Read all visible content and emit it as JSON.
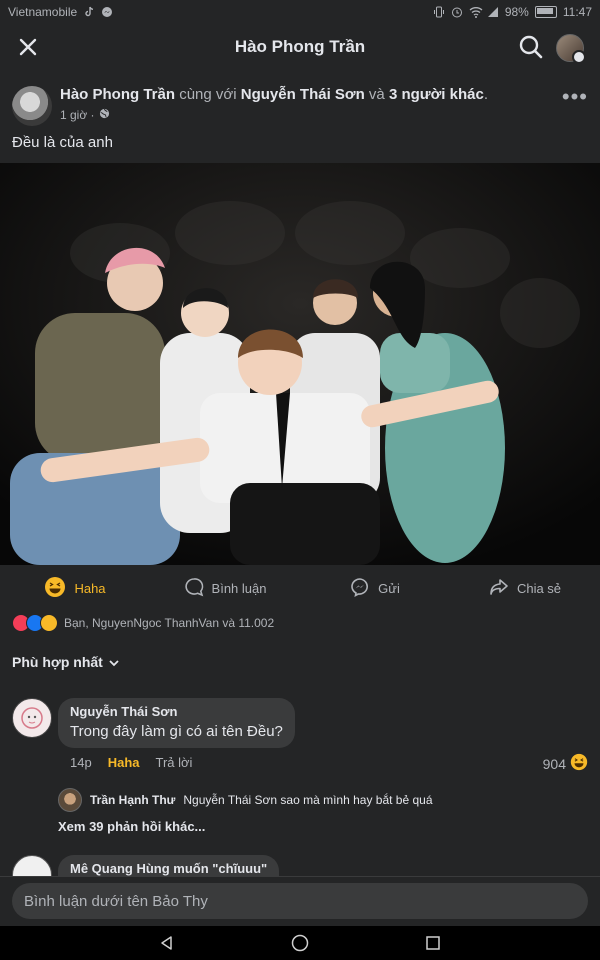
{
  "status_bar": {
    "carrier": "Vietnamobile",
    "battery": "98%",
    "time": "11:47"
  },
  "header": {
    "title": "Hào Phong Trần"
  },
  "post": {
    "author": "Hào Phong Trần",
    "with_text": "cùng với",
    "tagged": "Nguyễn Thái Sơn",
    "and_text": "và",
    "others": "3 người khác",
    "time": "1 giờ ·",
    "more": "•••",
    "caption": "Đều là của anh"
  },
  "actions": [
    {
      "label": "Haha",
      "icon": "haha-icon"
    },
    {
      "label": "Bình luận",
      "icon": "comment-icon"
    },
    {
      "label": "Gửi",
      "icon": "messenger-icon"
    },
    {
      "label": "Chia sẻ",
      "icon": "share-icon"
    }
  ],
  "reactions": {
    "summary": "Bạn, NguyenNgoc ThanhVan và 11.002"
  },
  "sort": {
    "label": "Phù hợp nhất"
  },
  "comments": [
    {
      "name": "Nguyễn Thái Sơn",
      "text": "Trong đây làm gì có ai tên Đều?",
      "time": "14p",
      "reaction_label": "Haha",
      "reply_label": "Trả lời",
      "count": "904"
    }
  ],
  "reply": {
    "name": "Trần Hạnh Thư",
    "text": "Nguyễn Thái Sơn sao mà mình hay bắt bẻ quá"
  },
  "more_replies": "Xem 39 phản hồi khác...",
  "comment2": {
    "name": "Mê Quang Hùng muốn \"chĩuuu\""
  },
  "composer": {
    "placeholder": "Bình luận dưới tên Bảo Thy"
  },
  "colors": {
    "background": "#242526",
    "bubble": "#3a3b3c",
    "haha_accent": "#f7b928",
    "text": "#e4e6eb",
    "muted": "#b0b3b8"
  }
}
